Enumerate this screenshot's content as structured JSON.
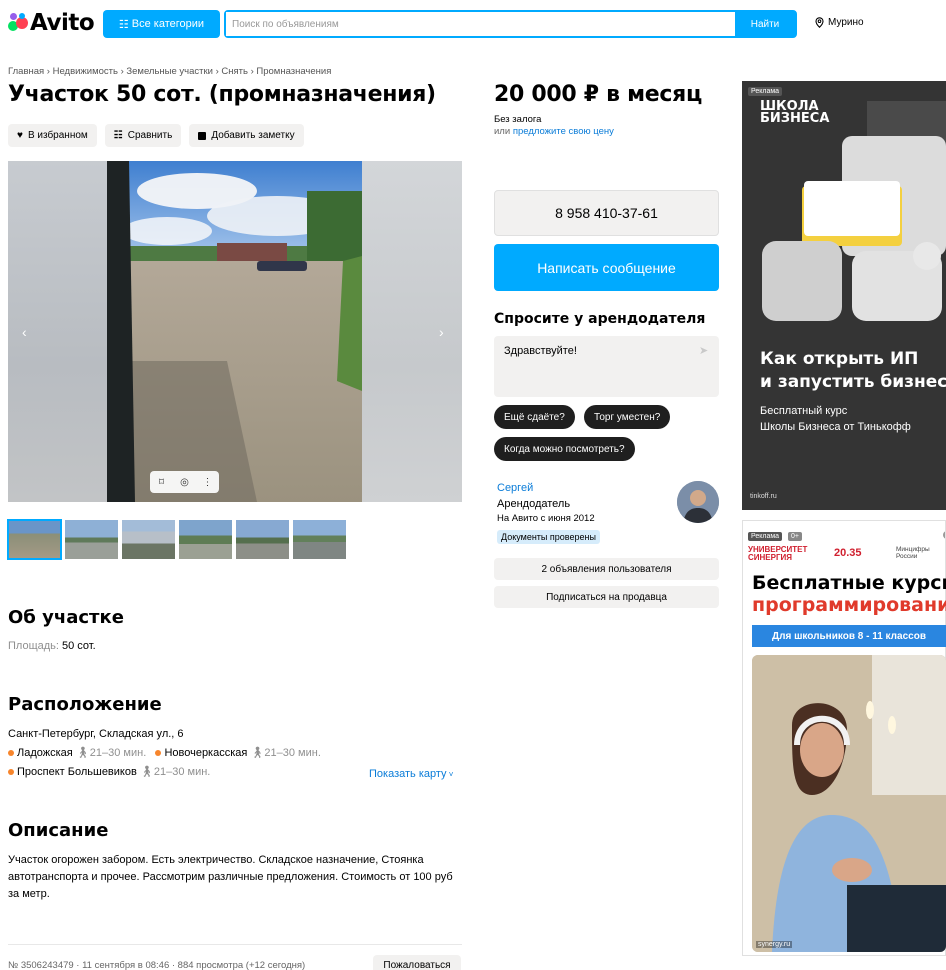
{
  "header": {
    "logo": "Avito",
    "categories_label": "Все категории",
    "search_placeholder": "Поиск по объявлениям",
    "search_button": "Найти",
    "location": "Мурино"
  },
  "breadcrumb": "Главная › Недвижимость › Земельные участки › Снять › Промназначения",
  "title": "Участок 50 сот. (промназначения)",
  "actions": {
    "favorite": "В избранном",
    "compare": "Сравнить",
    "note": "Добавить заметку"
  },
  "about": {
    "heading": "Об участке",
    "area_label": "Площадь:",
    "area_value": "50 сот."
  },
  "location": {
    "heading": "Расположение",
    "address": "Санкт-Петербург, Складская ул., 6",
    "metro": [
      {
        "name": "Ладожская",
        "time": "21–30 мин."
      },
      {
        "name": "Новочеркасская",
        "time": "21–30 мин."
      },
      {
        "name": "Проспект Большевиков",
        "time": "21–30 мин."
      }
    ],
    "show_map": "Показать карту"
  },
  "description": {
    "heading": "Описание",
    "text": "Участок огорожен забором. Есть электричество. Складское назначение, Стоянка автотранспорта и прочее. Рассмотрим различные предложения. Стоимость от 100 руб за метр."
  },
  "footer": {
    "meta": "№ 3506243479 · 11 сентября в 08:46 · 884 просмотра (+12 сегодня)",
    "complain": "Пожаловаться"
  },
  "price": {
    "value": "20 000 ₽ в месяц",
    "deposit": "Без залога",
    "offer_prefix": "или",
    "offer_link": "предложите свою цену"
  },
  "contact": {
    "phone": "8 958 410-37-61",
    "message_button": "Написать сообщение",
    "ask_heading": "Спросите у арендодателя",
    "ask_text": "Здравствуйте!",
    "chips": [
      "Ещё сдаёте?",
      "Торг уместен?",
      "Когда можно посмотреть?"
    ]
  },
  "seller": {
    "name": "Сергей",
    "role": "Арендодатель",
    "since": "На Авито с июня 2012",
    "verified": "Документы проверены",
    "listings": "2 объявления пользователя",
    "subscribe": "Подписаться на продавца"
  },
  "ad1": {
    "label": "Реклама",
    "brand": "ШКОЛА\nБИЗНЕСА",
    "heading": "Как открыть ИП\nи запустить бизнес",
    "subtitle": "Бесплатный курс\nШколы Бизнеса от Тинькофф",
    "source": "tinkoff.ru"
  },
  "ad2": {
    "label": "Реклама",
    "age": "0+",
    "brand": "УНИВЕРСИТЕТ СИНЕРГИЯ",
    "badge": "20.35",
    "ministry": "Минцифры России",
    "heading1": "Бесплатные курсы",
    "heading2": "программирования",
    "cta": "Для школьников 8 - 11 классов",
    "source": "synergy.ru"
  },
  "colors": {
    "accent": "#00aaff",
    "link": "#0a7cd8",
    "chip": "#1f1f1f",
    "metro_dot": "#f7852c",
    "ad_red": "#e03a2b"
  }
}
